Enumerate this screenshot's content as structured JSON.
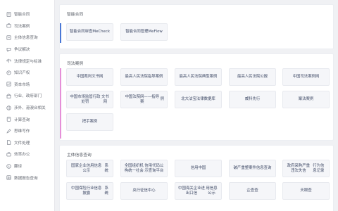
{
  "colors": {
    "sidebar_bg": "#ffffff",
    "page_bg": "#f0f1f4",
    "card_text": "#3f4a66",
    "accent_blue": "#4a78d6",
    "accent_pink": "#e58fd8"
  },
  "sidebar": {
    "items": [
      {
        "label": "智能合同",
        "icon": "contract-icon"
      },
      {
        "label": "司法案例",
        "icon": "case-icon"
      },
      {
        "label": "主体信息查询",
        "icon": "entity-search-icon"
      },
      {
        "label": "争议解决",
        "icon": "dispute-icon"
      },
      {
        "label": "法律规定与标准",
        "icon": "law-icon"
      },
      {
        "label": "知识产权",
        "icon": "ip-icon"
      },
      {
        "label": "资本市场",
        "icon": "capital-icon"
      },
      {
        "label": "行业、政府部门",
        "icon": "government-icon"
      },
      {
        "label": "涉外、港澳台相关",
        "icon": "globe-icon"
      },
      {
        "label": "计算查询",
        "icon": "calculator-icon"
      },
      {
        "label": "思维写作",
        "icon": "writing-icon"
      },
      {
        "label": "文件处理",
        "icon": "file-icon"
      },
      {
        "label": "效率办公",
        "icon": "office-icon"
      },
      {
        "label": "翻译",
        "icon": "translate-icon"
      },
      {
        "label": "数据报告查询",
        "icon": "report-icon"
      }
    ]
  },
  "sections": {
    "contract": {
      "title": "智能合同",
      "cards": [
        {
          "lines": [
            "智能合同审查",
            "MeCheck"
          ]
        },
        {
          "lines": [
            "智能合同管理MeFlow"
          ]
        }
      ]
    },
    "cases": {
      "title": "司法案例",
      "cards": [
        {
          "lines": [
            "中国裁判文书网"
          ]
        },
        {
          "lines": [
            "最高人民法院指导案例"
          ]
        },
        {
          "lines": [
            "最高人民法院典型案例"
          ]
        },
        {
          "lines": [
            "最高人民法院公报"
          ]
        },
        {
          "lines": [
            "中国司法案例网"
          ]
        },
        {
          "lines": [
            "中国市场监管行政处罚",
            "文书网"
          ]
        },
        {
          "lines": [
            "中国法院网——指导案",
            "例"
          ]
        },
        {
          "lines": [
            "北大法宝法律数据库"
          ]
        },
        {
          "lines": [
            "威科先行"
          ]
        },
        {
          "lines": [
            "聚法案例"
          ]
        },
        {
          "lines": [
            "把手案例"
          ]
        }
      ]
    },
    "entity": {
      "title": "主体信息查询",
      "cards": [
        {
          "lines": [
            "国家企业信用信息公示",
            "系统"
          ]
        },
        {
          "lines": [
            "全国组织机构统一社会",
            "信用代码公示查询平台"
          ]
        },
        {
          "lines": [
            "信用中国"
          ]
        },
        {
          "lines": [
            "破产重整案件信息查询"
          ]
        },
        {
          "lines": [
            "政府采购严重违法失信",
            "行为信息记录"
          ]
        },
        {
          "lines": [
            "中国保险行业信息披露",
            "系统"
          ]
        },
        {
          "lines": [
            "央行征信中心"
          ]
        },
        {
          "lines": [
            "中国海关企业进出口信",
            "用信息公示"
          ]
        },
        {
          "lines": [
            "企查查"
          ]
        },
        {
          "lines": [
            "天眼查"
          ]
        }
      ]
    }
  }
}
